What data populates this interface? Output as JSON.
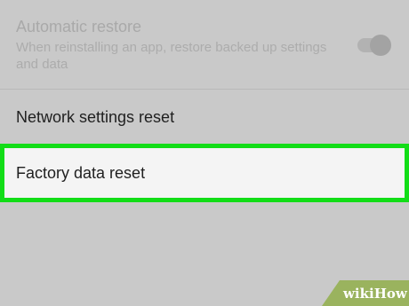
{
  "automatic_restore": {
    "title": "Automatic restore",
    "description": "When reinstalling an app, restore backed up settings and data",
    "toggle_state": "on",
    "disabled": true
  },
  "network_reset": {
    "label": "Network settings reset"
  },
  "factory_reset": {
    "label": "Factory data reset",
    "highlight_color": "#12dd17"
  },
  "watermark": {
    "text": "wikiHow"
  },
  "colors": {
    "background": "#c9c9c9",
    "highlighted_row": "#f4f4f4",
    "watermark_bg": "#9ab35e"
  }
}
